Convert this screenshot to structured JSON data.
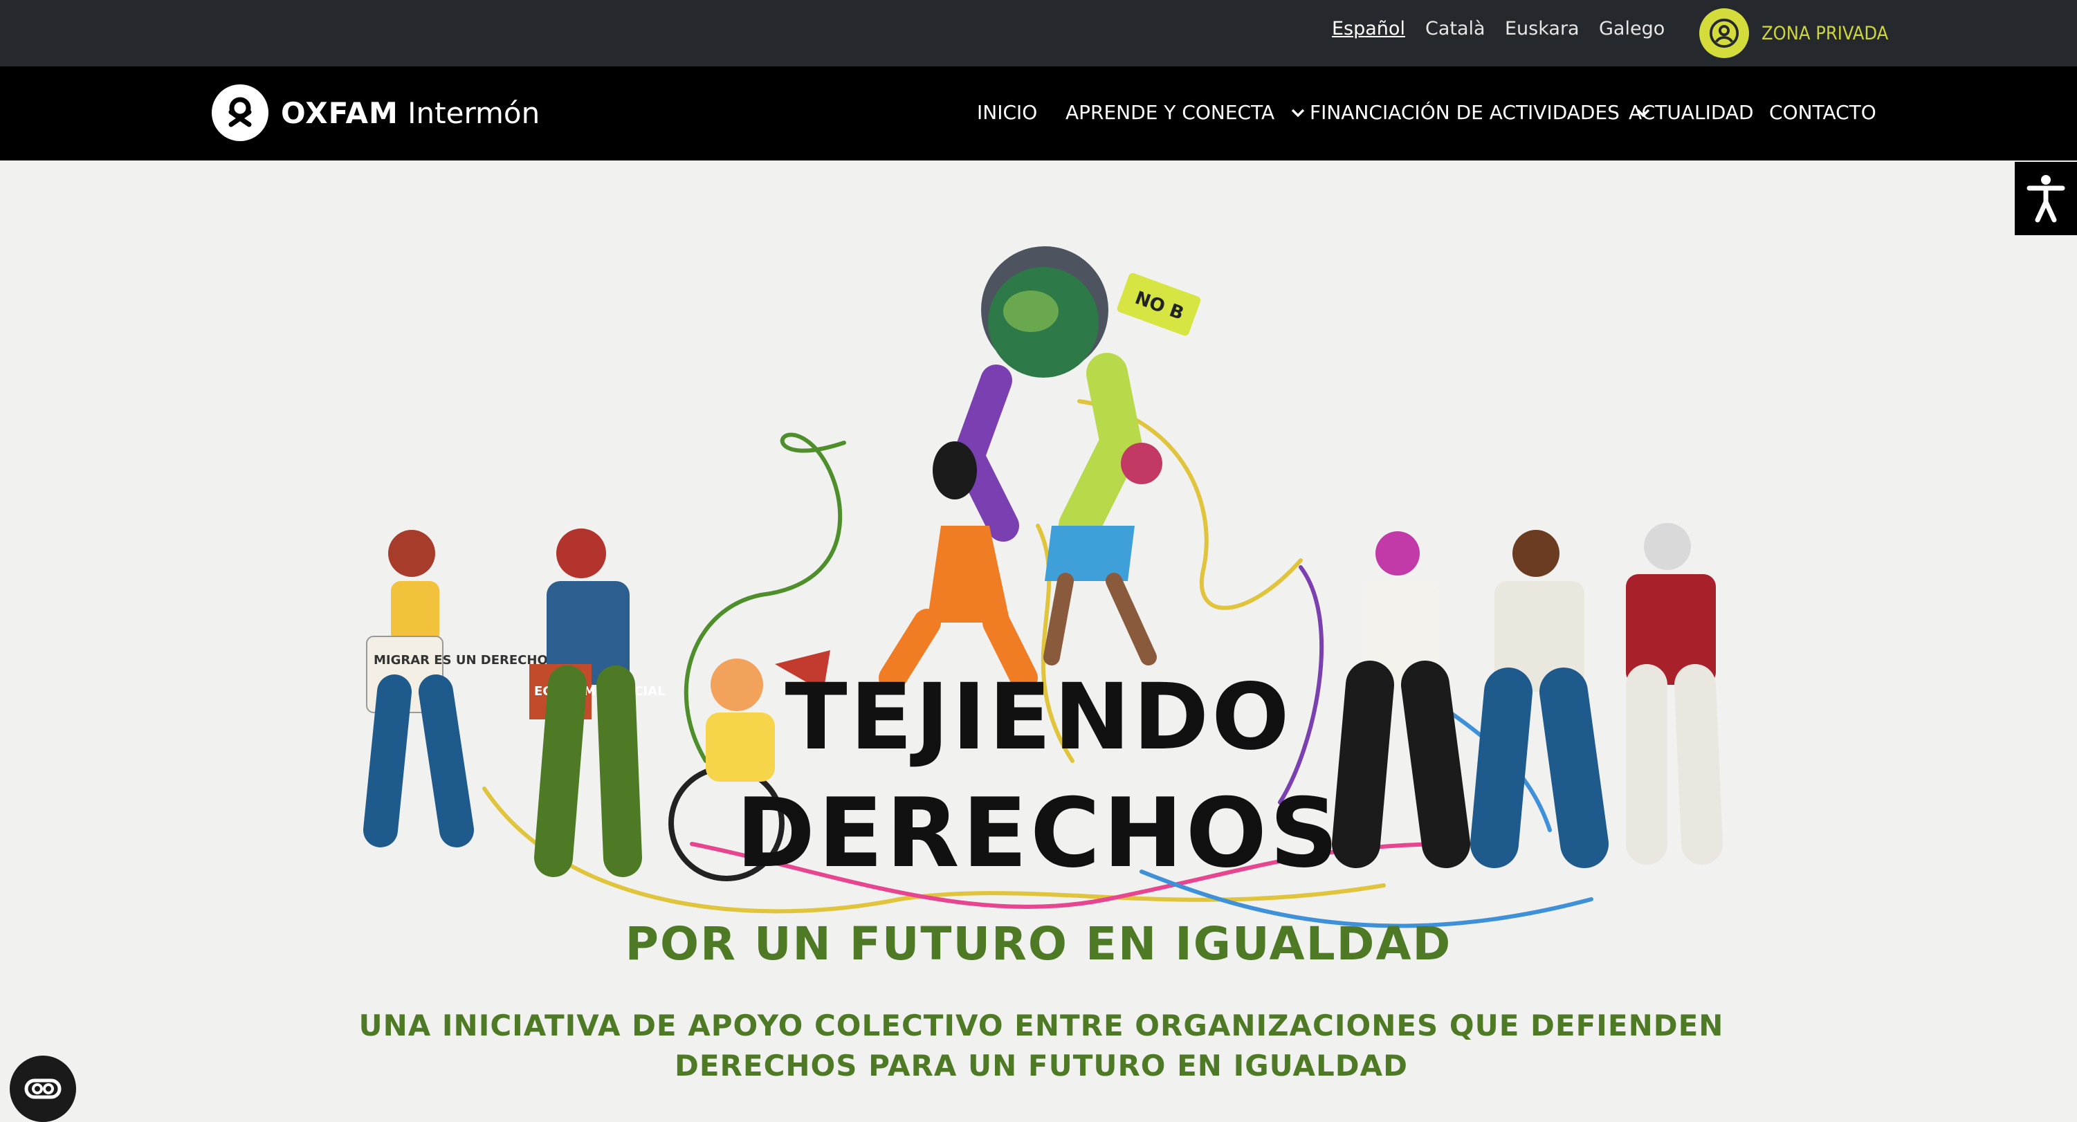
{
  "languages": [
    {
      "label": "Español",
      "active": true
    },
    {
      "label": "Català",
      "active": false
    },
    {
      "label": "Euskara",
      "active": false
    },
    {
      "label": "Galego",
      "active": false
    }
  ],
  "private_zone": {
    "label": "ZONA PRIVADA",
    "icon": "user-circle-icon"
  },
  "logo": {
    "brand": "OXFAM",
    "name": "Intermón"
  },
  "nav": [
    {
      "label": "INICIO",
      "dropdown": false
    },
    {
      "label": "APRENDE Y CONECTA",
      "dropdown": true
    },
    {
      "label": "FINANCIACIÓN DE ACTIVIDADES",
      "dropdown": true
    },
    {
      "label": "ACTUALIDAD",
      "dropdown": false
    },
    {
      "label": "CONTACTO",
      "dropdown": false
    }
  ],
  "accessibility": {
    "icon": "accessibility-icon"
  },
  "hero": {
    "title_line1": "TEJIENDO",
    "title_line2": "DERECHOS",
    "subtitle": "POR UN FUTURO EN IGUALDAD",
    "tote_text": "MIGRAR ES UN DERECHO",
    "crate_text": "ECONOMÍA SOCIAL",
    "sign_text": "NO B"
  },
  "tagline": "UNA INICIATIVA DE APOYO COLECTIVO ENTRE ORGANIZACIONES QUE DEFIENDEN DERECHOS PARA UN FUTURO EN IGUALDAD",
  "chat_widget": {
    "icon": "chat-eye-icon"
  },
  "colors": {
    "topbar": "#25282c",
    "navbar": "#000000",
    "accent_lime": "#d3dc3a",
    "green_text": "#4f7a25",
    "background": "#f1f1f0"
  }
}
